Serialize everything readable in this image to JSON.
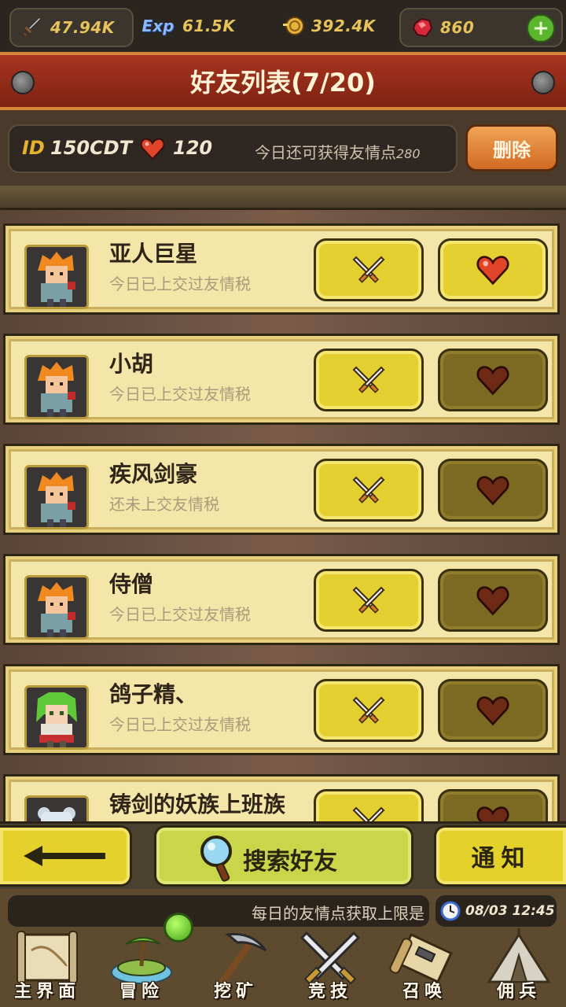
{
  "resources": [
    {
      "icon": "sword-icon",
      "value": "47.94K"
    },
    {
      "icon": "exp-icon",
      "value": "61.5K"
    },
    {
      "icon": "coin-icon",
      "value": "392.4K"
    },
    {
      "icon": "ruby-gem-icon",
      "value": "860"
    }
  ],
  "exp_badge": "Exp",
  "header": {
    "title": "好友列表(7/20)"
  },
  "info": {
    "id_label": "ID",
    "id_value": "150CDT",
    "hearts": "120",
    "remaining_text": "今日还可获得友情点",
    "remaining_value": "280",
    "delete_label": "删除"
  },
  "friends": [
    {
      "name": "亚人巨星",
      "status": "今日已上交过友情税",
      "heart_active": true,
      "avatar": "orange-hair-knight"
    },
    {
      "name": "小胡",
      "status": "今日已上交过友情税",
      "heart_active": false,
      "avatar": "orange-hair-knight"
    },
    {
      "name": "疾风剑豪",
      "status": "还未上交友情税",
      "heart_active": false,
      "avatar": "orange-hair-knight"
    },
    {
      "name": "侍僧",
      "status": "今日已上交过友情税",
      "heart_active": false,
      "avatar": "orange-hair-knight"
    },
    {
      "name": "鸽子精、",
      "status": "今日已上交过友情税",
      "heart_active": false,
      "avatar": "green-hair-girl"
    },
    {
      "name": "铸剑的妖族上班族",
      "status": "",
      "heart_active": false,
      "avatar": "white-bear"
    }
  ],
  "actions": {
    "search_label": "搜索好友",
    "notice_label": "通知"
  },
  "ticker": {
    "message": "每日的友情点获取上限是",
    "time": "08/03 12:45"
  },
  "nav": [
    {
      "label": "主界面",
      "icon": "map-scroll-icon"
    },
    {
      "label": "冒险",
      "icon": "island-icon"
    },
    {
      "label": "挖矿",
      "icon": "pickaxe-icon"
    },
    {
      "label": "竞技",
      "icon": "crossed-swords-icon"
    },
    {
      "label": "召唤",
      "icon": "summon-scroll-icon"
    },
    {
      "label": "佣兵",
      "icon": "tent-icon"
    }
  ],
  "colors": {
    "accent_yellow": "#e4cf30",
    "banner_red": "#a8341f",
    "delete_orange": "#e4862e",
    "heart_red": "#e0452a"
  }
}
